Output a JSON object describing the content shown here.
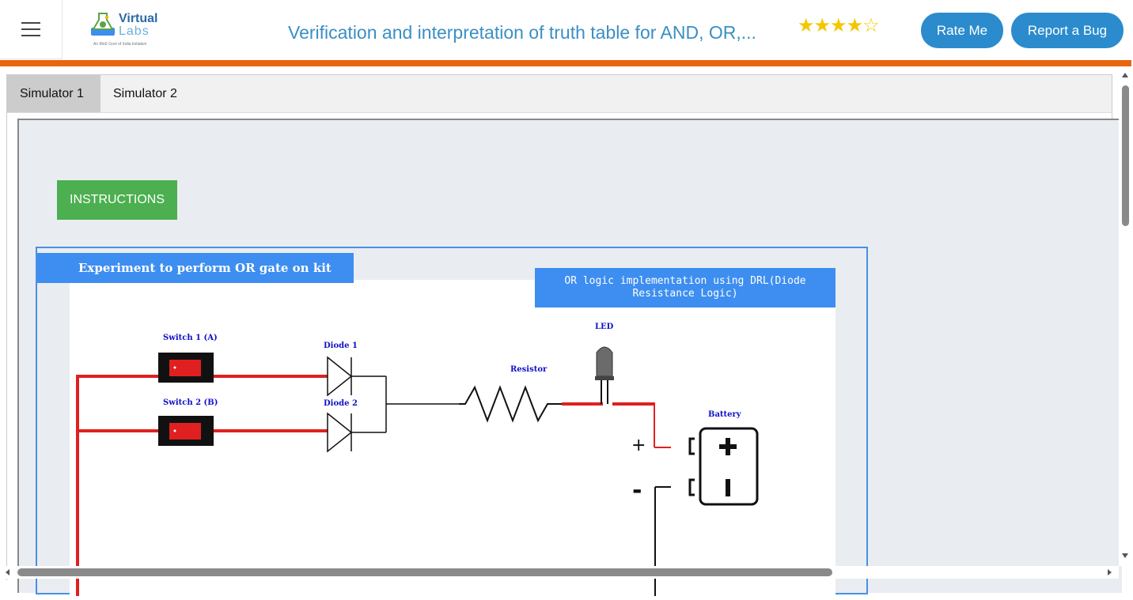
{
  "header": {
    "menu_icon": "hamburger-menu-icon",
    "logo": {
      "line1": "Virtual",
      "line2": "Labs",
      "tagline": "An MoE Govt of India Initiative"
    },
    "title": "Verification and interpretation of truth table for AND, OR,...",
    "rating": {
      "filled": 4,
      "total": 5,
      "filled_glyph": "★★★★",
      "empty_glyph": "☆"
    },
    "rate_button": "Rate Me",
    "bug_button": "Report a Bug"
  },
  "tabs": [
    {
      "label": "Simulator 1",
      "active": true
    },
    {
      "label": "Simulator 2",
      "active": false
    }
  ],
  "simulator": {
    "instructions_button": "INSTRUCTIONS",
    "experiment_title": "Experiment to perform OR gate on kit",
    "or_title": "OR logic implementation using DRL(Diode Resistance Logic)",
    "labels": {
      "switch1": "Switch 1 (A)",
      "switch2": "Switch 2 (B)",
      "diode1": "Diode 1",
      "diode2": "Diode 2",
      "resistor": "Resistor",
      "led": "LED",
      "battery": "Battery",
      "plus": "+",
      "minus": "-"
    }
  },
  "colors": {
    "accent": "#2b8bcd",
    "orange_bar": "#e8660f",
    "instructions_green": "#4caf50",
    "title_blue": "#3d8ef0",
    "wire_red": "#e02020"
  }
}
